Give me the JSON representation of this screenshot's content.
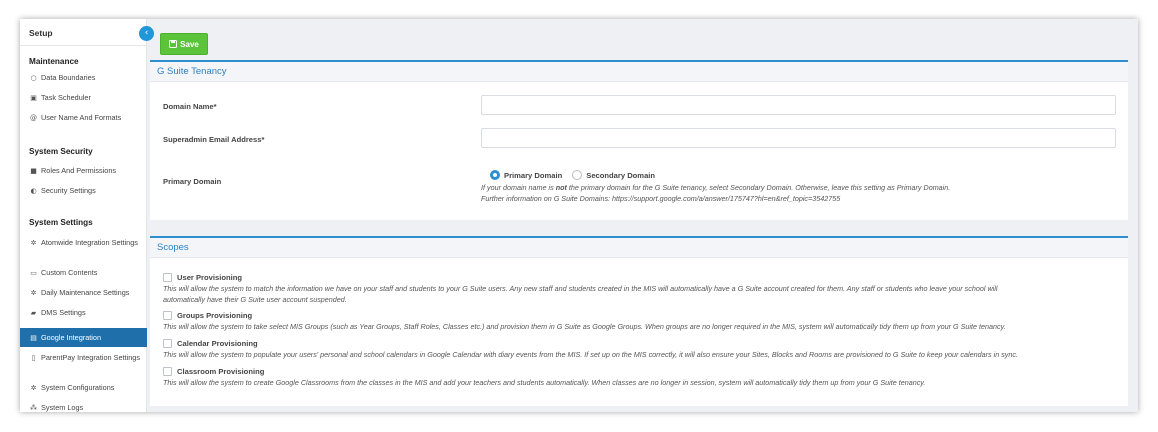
{
  "sidebar": {
    "title": "Setup",
    "collapse_glyph": "‹",
    "sections": [
      {
        "title": "Maintenance",
        "items": [
          {
            "label": "Data Boundaries",
            "icon": "circle-icon",
            "glyph": "○"
          },
          {
            "label": "Task Scheduler",
            "icon": "calendar-icon",
            "glyph": "▣"
          },
          {
            "label": "User Name And Formats",
            "icon": "at-icon",
            "glyph": "@"
          }
        ]
      },
      {
        "title": "System Security",
        "items": [
          {
            "label": "Roles And Permissions",
            "icon": "lock-icon",
            "glyph": "■"
          },
          {
            "label": "Security Settings",
            "icon": "shield-icon",
            "glyph": "◐"
          }
        ]
      },
      {
        "title": "System Settings",
        "items": [
          {
            "label": "Atomwide Integration Settings",
            "icon": "gear-icon",
            "glyph": "✲"
          },
          {
            "label": "Custom Contents",
            "icon": "keyboard-icon",
            "glyph": "▭"
          },
          {
            "label": "Daily Maintenance Settings",
            "icon": "gear-icon",
            "glyph": "✲"
          },
          {
            "label": "DMS Settings",
            "icon": "folder-icon",
            "glyph": "▰"
          },
          {
            "label": "Google Integration",
            "icon": "card-icon",
            "glyph": "▤",
            "active": true
          },
          {
            "label": "ParentPay Integration Settings",
            "icon": "document-icon",
            "glyph": "▯"
          },
          {
            "label": "System Configurations",
            "icon": "gear-icon",
            "glyph": "✲"
          },
          {
            "label": "System Logs",
            "icon": "sitemap-icon",
            "glyph": "⁂"
          }
        ]
      }
    ]
  },
  "toolbar": {
    "save_label": "Save",
    "save_icon": "save-icon"
  },
  "tenancy": {
    "title": "G Suite Tenancy",
    "domain_label": "Domain Name*",
    "domain_value": "",
    "email_label": "Superadmin Email Address*",
    "email_value": "",
    "primary_label": "Primary Domain",
    "radio_primary": "Primary Domain",
    "radio_secondary": "Secondary Domain",
    "selected": "Primary Domain",
    "help_pre": "If your domain name is ",
    "help_not": "not",
    "help_post": " the primary domain for the G Suite tenancy, select Secondary Domain. Otherwise, leave this setting as Primary Domain.",
    "help_info": "Further information on G Suite Domains: https://support.google.com/a/answer/175747?hl=en&ref_topic=3542755"
  },
  "scopes": {
    "title": "Scopes",
    "items": [
      {
        "label": "User Provisioning",
        "checked": false,
        "desc_lines": [
          "This will allow the system to match the information we have on your staff and students to your G Suite users. Any new staff and students created in the MIS will automatically have a G Suite account created for them. Any staff or students who leave your school will",
          "automatically have their G Suite user account suspended."
        ]
      },
      {
        "label": "Groups Provisioning",
        "checked": false,
        "desc_lines": [
          "This will allow the system to take select MIS Groups (such as Year Groups, Staff Roles, Classes etc.) and provision them in G Suite as Google Groups. When groups are no longer required in the MIS, system will automatically tidy them up from your G Suite tenancy."
        ]
      },
      {
        "label": "Calendar Provisioning",
        "checked": false,
        "desc_lines": [
          "This will allow the system to populate your users' personal and school calendars in Google Calendar with diary events from the MIS. If set up on the MIS correctly, it will also ensure your Sites, Blocks and Rooms are provisioned to G Suite to keep your calendars in sync."
        ]
      },
      {
        "label": "Classroom Provisioning",
        "checked": false,
        "desc_lines": [
          "This will allow the system to create Google Classrooms from the classes in the MIS and add your teachers and students automatically. When classes are no longer in session, system will automatically tidy them up from your G Suite tenancy."
        ]
      }
    ]
  }
}
